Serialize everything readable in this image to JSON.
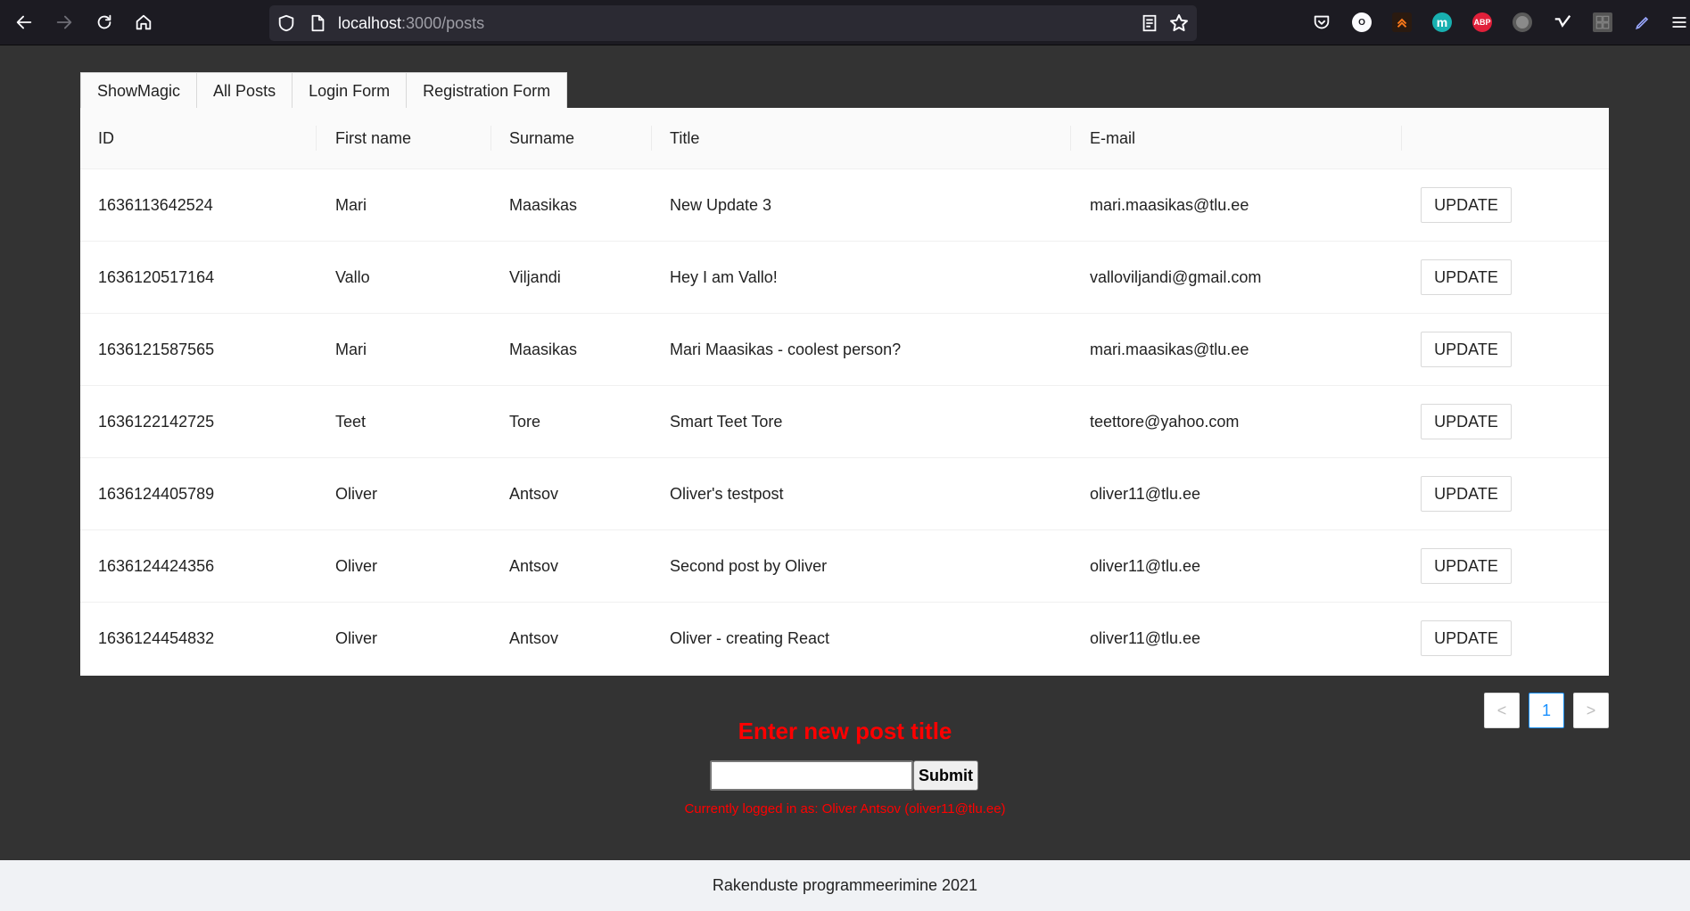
{
  "browser": {
    "url_host": "localhost",
    "url_path": ":3000/posts",
    "extensions": [
      {
        "name": "pocket-icon"
      },
      {
        "name": "o-icon",
        "text": "O"
      },
      {
        "name": "arrow-up-icon"
      },
      {
        "name": "m-icon",
        "text": "m",
        "color": "#18b0b0"
      },
      {
        "name": "abp-icon",
        "text": "ABP",
        "color": "#e0203a"
      },
      {
        "name": "circle-icon"
      },
      {
        "name": "check-icon"
      },
      {
        "name": "grid-icon"
      },
      {
        "name": "pen-icon"
      },
      {
        "name": "menu-icon"
      }
    ]
  },
  "tabs": [
    "ShowMagic",
    "All Posts",
    "Login Form",
    "Registration Form"
  ],
  "table": {
    "columns": [
      "ID",
      "First name",
      "Surname",
      "Title",
      "E-mail"
    ],
    "rows": [
      {
        "id": "1636113642524",
        "first": "Mari",
        "surname": "Maasikas",
        "title": "New Update 3",
        "email": "mari.maasikas@tlu.ee"
      },
      {
        "id": "1636120517164",
        "first": "Vallo",
        "surname": "Viljandi",
        "title": "Hey I am Vallo!",
        "email": "valloviljandi@gmail.com"
      },
      {
        "id": "1636121587565",
        "first": "Mari",
        "surname": "Maasikas",
        "title": "Mari Maasikas - coolest person?",
        "email": "mari.maasikas@tlu.ee"
      },
      {
        "id": "1636122142725",
        "first": "Teet",
        "surname": "Tore",
        "title": "Smart Teet Tore",
        "email": "teettore@yahoo.com"
      },
      {
        "id": "1636124405789",
        "first": "Oliver",
        "surname": "Antsov",
        "title": "Oliver's testpost",
        "email": "oliver11@tlu.ee"
      },
      {
        "id": "1636124424356",
        "first": "Oliver",
        "surname": "Antsov",
        "title": "Second post by Oliver",
        "email": "oliver11@tlu.ee"
      },
      {
        "id": "1636124454832",
        "first": "Oliver",
        "surname": "Antsov",
        "title": "Oliver - creating React",
        "email": "oliver11@tlu.ee"
      }
    ],
    "update_label": "UPDATE"
  },
  "pagination": {
    "prev": "<",
    "current": "1",
    "next": ">"
  },
  "form": {
    "title": "Enter new post title",
    "input_value": "",
    "submit_label": "Submit",
    "logged_in": "Currently logged in as: Oliver Antsov (oliver11@tlu.ee)"
  },
  "footer": {
    "text": "Rakenduste programmeerimine 2021"
  },
  "colors": {
    "background": "#333333",
    "accent": "#1890ff",
    "error_red": "#ff0000"
  }
}
